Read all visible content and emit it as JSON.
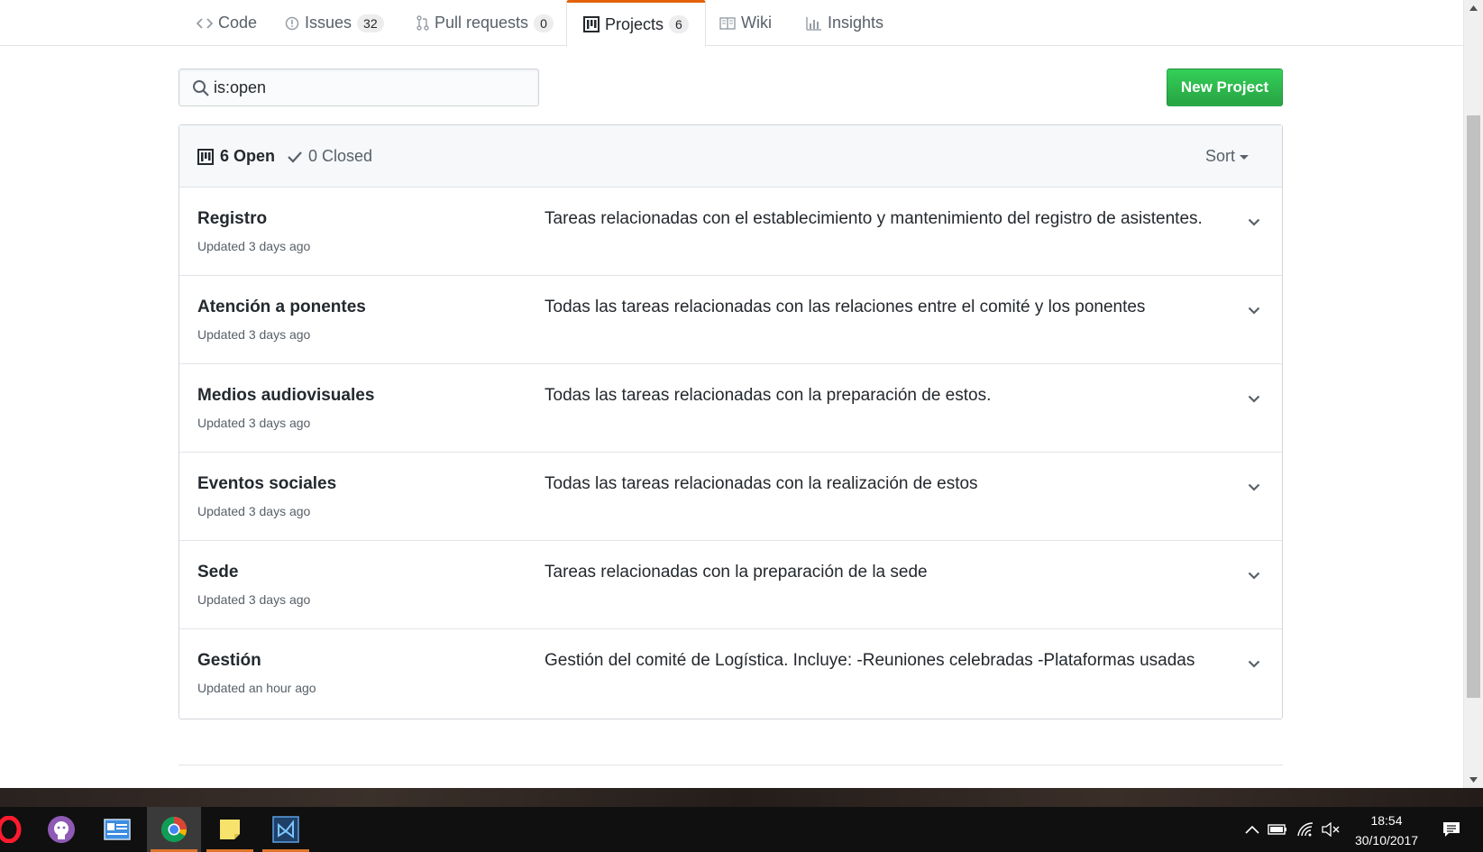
{
  "repo_nav": {
    "tabs": [
      {
        "label": "Code",
        "icon": "code-icon"
      },
      {
        "label": "Issues",
        "count": "32",
        "icon": "issue-opened-icon"
      },
      {
        "label": "Pull requests",
        "count": "0",
        "icon": "git-pull-request-icon"
      },
      {
        "label": "Projects",
        "count": "6",
        "icon": "project-icon",
        "selected": true
      },
      {
        "label": "Wiki",
        "icon": "book-icon"
      },
      {
        "label": "Insights",
        "icon": "graph-icon"
      }
    ]
  },
  "search": {
    "value": "is:open",
    "placeholder": ""
  },
  "new_project_label": "New Project",
  "projects_header": {
    "open_label": "6 Open",
    "closed_label": "0 Closed",
    "sort_label": "Sort"
  },
  "projects": [
    {
      "name": "Registro",
      "updated": "Updated 3 days ago",
      "description": "Tareas relacionadas con el establecimiento y mantenimiento del registro de asistentes."
    },
    {
      "name": "Atención a ponentes",
      "updated": "Updated 3 days ago",
      "description": "Todas las tareas relacionadas con las relaciones entre el comité y los ponentes"
    },
    {
      "name": "Medios audiovisuales",
      "updated": "Updated 3 days ago",
      "description": "Todas las tareas relacionadas con la preparación de estos."
    },
    {
      "name": "Eventos sociales",
      "updated": "Updated 3 days ago",
      "description": "Todas las tareas relacionadas con la realización de estos"
    },
    {
      "name": "Sede",
      "updated": "Updated 3 days ago",
      "description": "Tareas relacionadas con la preparación de la sede"
    },
    {
      "name": "Gestión",
      "updated": "Updated an hour ago",
      "description": "Gestión del comité de Logística. Incluye: -Reuniones celebradas -Plataformas usadas"
    }
  ],
  "taskbar": {
    "apps": [
      "opera-icon",
      "github-desktop-icon",
      "control-panel-icon",
      "chrome-icon",
      "sticky-notes-icon",
      "visual-studio-icon"
    ],
    "tray": [
      "chevron-up-icon",
      "battery-icon",
      "wifi-icon",
      "volume-muted-icon",
      "notifications-icon"
    ],
    "time": "18:54",
    "date": "30/10/2017"
  },
  "colors": {
    "accent_tab": "#e36209",
    "new_project_green": "#28a745"
  }
}
